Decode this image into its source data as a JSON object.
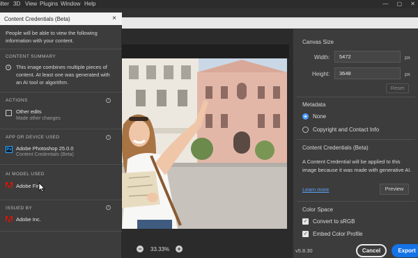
{
  "menubar": {
    "items": [
      "ilter",
      "3D",
      "View",
      "Plugins",
      "Window",
      "Help"
    ]
  },
  "cc_panel": {
    "title": "Content Credentials (Beta)",
    "close_glyph": "×",
    "intro": "People will be able to view the following information with your content.",
    "summary": {
      "heading": "CONTENT SUMMARY",
      "text": "This image combines multiple pieces of content. At least one was generated with an AI tool or algorithm."
    },
    "actions": {
      "heading": "ACTIONS",
      "title": "Other edits",
      "subtitle": "Made other changes"
    },
    "app": {
      "heading": "APP OR DEVICE USED",
      "logo": "Ps",
      "title": "Adobe Photoshop 25.0.0",
      "subtitle": "Content Credentials (Beta)"
    },
    "ai_model": {
      "heading": "AI MODEL USED",
      "title": "Adobe Fir"
    },
    "issued_by": {
      "heading": "ISSUED BY",
      "title": "Adobe Inc."
    }
  },
  "canvas": {
    "zoom_out": "−",
    "zoom_in": "+",
    "zoom": "33.33%"
  },
  "right_panel": {
    "canvas_size": {
      "heading": "Canvas Size",
      "width_label": "Width:",
      "width_value": "5472",
      "height_label": "Height:",
      "height_value": "3648",
      "unit": "px",
      "reset": "Reset"
    },
    "metadata": {
      "heading": "Metadata",
      "options": [
        "None",
        "Copyright and Contact Info"
      ],
      "selected": "None"
    },
    "content_credentials": {
      "heading": "Content Credentials (Beta)",
      "description": "A Content Credential will be applied to this image because it was made with generative AI.",
      "learn_more": "Learn more",
      "preview": "Preview"
    },
    "color_space": {
      "heading": "Color Space",
      "convert_srgb": "Convert to sRGB",
      "embed_profile": "Embed Color Profile",
      "convert_checked": true,
      "embed_checked": true
    },
    "version": "v5.8.30",
    "cancel": "Cancel",
    "export": "Export"
  },
  "colors": {
    "accent": "#1473e6",
    "link": "#5ea4ff",
    "panel_bg": "#3c3c3c"
  }
}
